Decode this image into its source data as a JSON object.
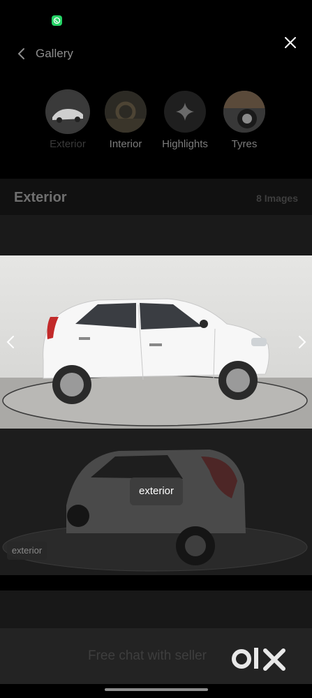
{
  "status_bar": {
    "app_icon": "whatsapp-icon"
  },
  "header": {
    "title": "Gallery",
    "back_icon": "chevron-left-icon",
    "close_icon": "close-icon"
  },
  "categories": [
    {
      "label": "Exterior",
      "active": true
    },
    {
      "label": "Interior",
      "active": false
    },
    {
      "label": "Highlights",
      "active": false,
      "icon": "sparkle-icon"
    },
    {
      "label": "Tyres",
      "active": false
    }
  ],
  "section": {
    "title": "Exterior",
    "count": "8 Images"
  },
  "photos": {
    "main": {
      "alt_icon": "car-side-view"
    },
    "secondary": {
      "tag_center": "exterior",
      "tag_left": "exterior"
    }
  },
  "footer": {
    "cta": "Free chat with seller",
    "brand": "OLX"
  },
  "colors": {
    "whatsapp": "#25d366",
    "background": "#000000"
  }
}
